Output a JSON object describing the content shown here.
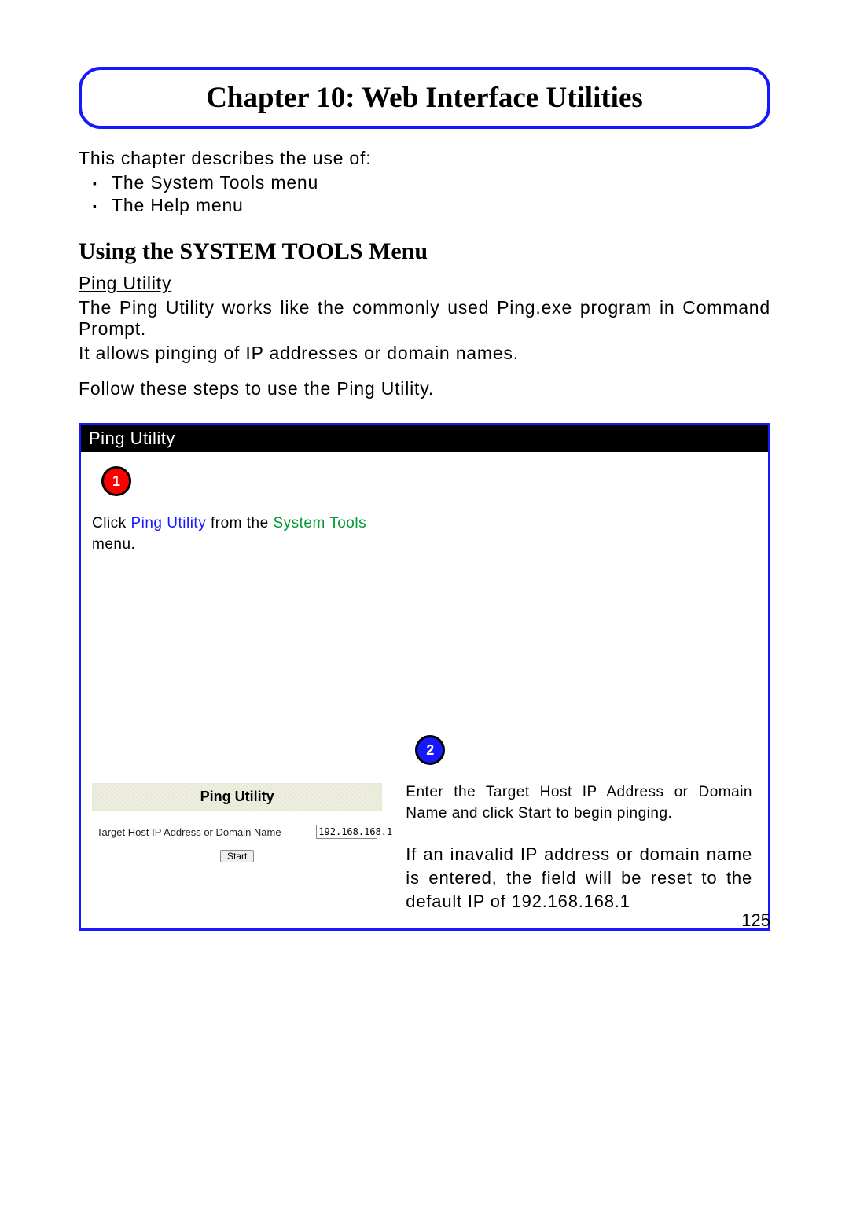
{
  "chapter": {
    "title": "Chapter 10: Web Interface Utilities"
  },
  "intro": {
    "lead": "This chapter describes the use of:",
    "items": [
      "The System Tools menu",
      "The Help menu"
    ]
  },
  "section": {
    "heading": "Using the SYSTEM TOOLS Menu",
    "sub": "Ping Utility",
    "p1": "The Ping Utility works like the commonly used Ping.exe program in Command Prompt.",
    "p2": "It allows pinging of IP addresses or domain names.",
    "p3": "Follow these steps to use the Ping Utility."
  },
  "panel": {
    "title": "Ping Utility",
    "step1": {
      "num": "1",
      "prefix": "Click ",
      "link1": "Ping Utility",
      "mid": " from the ",
      "link2": "System Tools",
      "suffix": " menu."
    },
    "widget": {
      "heading": "Ping Utility",
      "label": "Target Host IP Address or Domain Name",
      "value": "192.168.168.1",
      "button": "Start"
    },
    "step2": {
      "num": "2",
      "text1": "Enter the Target Host IP Address or Domain Name and click Start to begin pinging.",
      "text2": "If an inavalid IP address or domain name is entered, the field will be reset to the default IP of 192.168.168.1"
    }
  },
  "page_number": "125"
}
